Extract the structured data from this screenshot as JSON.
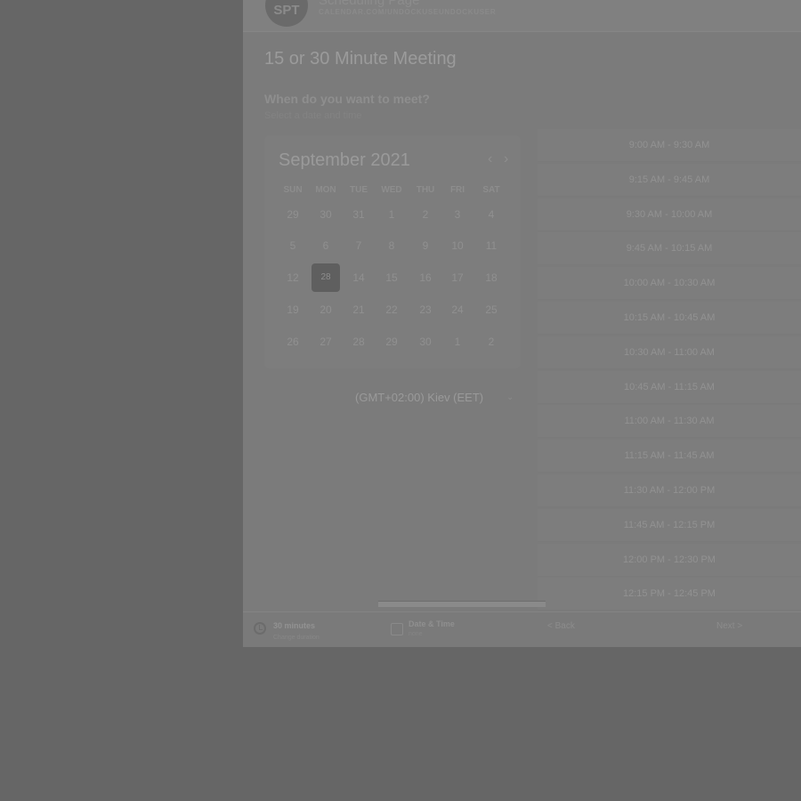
{
  "header": {
    "avatar_initials": "SPT",
    "page_name": "Scheduling Page",
    "url": "CALENDAR.COM/UNDOCKUSEUNDOCKUSER"
  },
  "event": {
    "title": "15 or 30 Minute Meeting"
  },
  "when": {
    "title": "When do you want to meet?",
    "subtitle": "Select a date and time"
  },
  "calendar": {
    "month_label": "September 2021",
    "weekdays": [
      "SUN",
      "MON",
      "TUE",
      "WED",
      "THU",
      "FRI",
      "SAT"
    ],
    "weeks": [
      [
        "29",
        "30",
        "31",
        "1",
        "2",
        "3",
        "4"
      ],
      [
        "5",
        "6",
        "7",
        "8",
        "9",
        "10",
        "11"
      ],
      [
        "12",
        "13",
        "14",
        "15",
        "16",
        "17",
        "18"
      ],
      [
        "19",
        "20",
        "21",
        "22",
        "23",
        "24",
        "25"
      ],
      [
        "26",
        "27",
        "28",
        "29",
        "30",
        "1",
        "2"
      ]
    ],
    "selected_day": "28"
  },
  "timezone": {
    "label": "(GMT+02:00) Kiev (EET)"
  },
  "time_slots": [
    "9:00 AM - 9:30 AM",
    "9:15 AM - 9:45 AM",
    "9:30 AM - 10:00 AM",
    "9:45 AM - 10:15 AM",
    "10:00 AM - 10:30 AM",
    "10:15 AM - 10:45 AM",
    "10:30 AM - 11:00 AM",
    "10:45 AM - 11:15 AM",
    "11:00 AM - 11:30 AM",
    "11:15 AM - 11:45 AM",
    "11:30 AM - 12:00 PM",
    "11:45 AM - 12:15 PM",
    "12:00 PM - 12:30 PM",
    "12:15 PM - 12:45 PM"
  ],
  "footer": {
    "duration_label": "30 minutes",
    "duration_sub": "Change duration",
    "datetime_label": "Date & Time",
    "datetime_sub": "none",
    "back_label": "< Back",
    "next_label": "Next >"
  }
}
